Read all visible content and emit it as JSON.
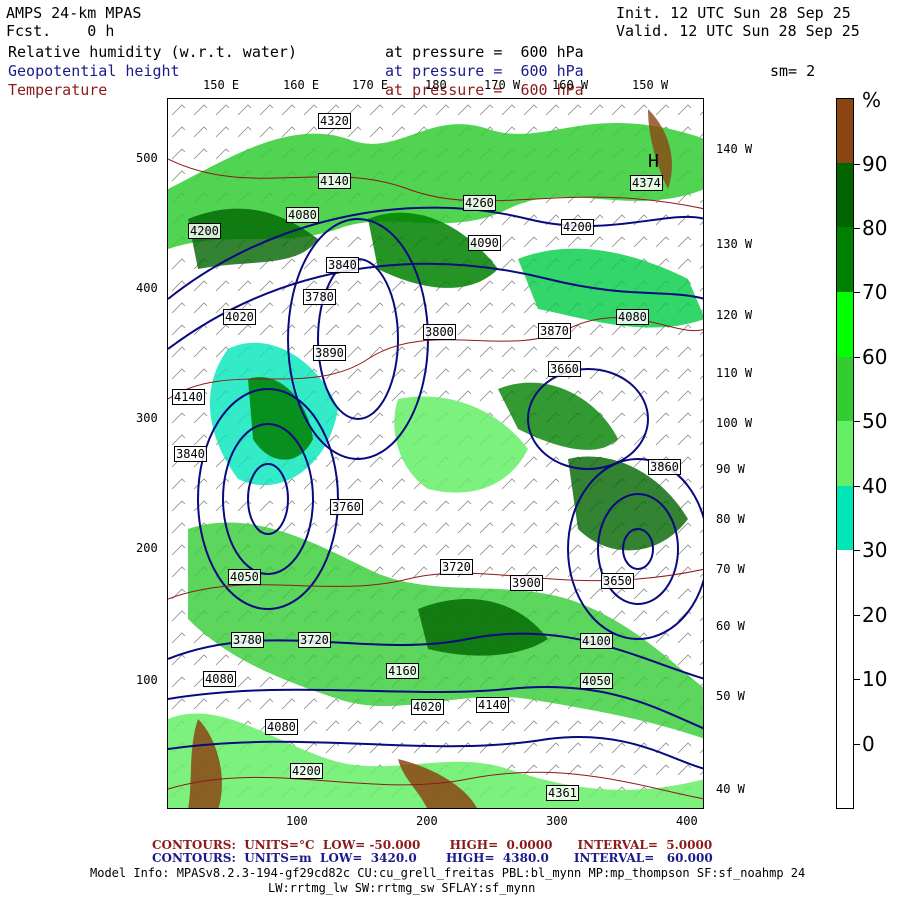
{
  "header": {
    "model": "AMPS 24-km MPAS",
    "fcst": "Fcst.    0 h",
    "init": "Init. 12 UTC Sun 28 Sep 25",
    "valid": "Valid. 12 UTC Sun 28 Sep 25"
  },
  "fields": [
    {
      "name": "Relative humidity (w.r.t. water)",
      "level": "at pressure =  600 hPa",
      "color": "#000000"
    },
    {
      "name": "Geopotential height",
      "level": "at pressure =  600 hPa",
      "color": "#1a1a8c"
    },
    {
      "name": "Temperature",
      "level": "at pressure =  600 hPa",
      "color": "#8b1a1a"
    }
  ],
  "smoothing": "sm= 2",
  "map": {
    "top_lon_labels": [
      "150 E",
      "160 E",
      "170 E",
      "180",
      "170 W",
      "160 W",
      "150 W"
    ],
    "right_lon_labels": [
      "140 W",
      "130 W",
      "120 W",
      "110 W",
      "100 W",
      "90 W",
      "80 W",
      "70 W",
      "60 W",
      "50 W",
      "40 W"
    ],
    "y_ticks": [
      "500",
      "400",
      "300",
      "200",
      "100"
    ],
    "x_ticks": [
      "100",
      "200",
      "300",
      "400"
    ],
    "height_labels": [
      "4320",
      "4140",
      "4080",
      "4200",
      "4260",
      "4090",
      "4200",
      "3840",
      "3780",
      "4020",
      "3800",
      "3890",
      "3870",
      "3660",
      "4080",
      "4140",
      "3840",
      "3760",
      "3720",
      "3900",
      "4050",
      "3780",
      "3720",
      "4080",
      "4080",
      "4160",
      "4020",
      "4140",
      "4200",
      "4361",
      "4374",
      "3650",
      "3860",
      "4100",
      "4050"
    ],
    "low_high_labels": [
      "H"
    ]
  },
  "colorbar": {
    "unit": "%",
    "labels": [
      "90",
      "80",
      "70",
      "60",
      "50",
      "40",
      "30",
      "20",
      "10",
      "0"
    ],
    "colors": [
      "#8b4513",
      "#006400",
      "#008000",
      "#00ff00",
      "#33cc33",
      "#66ee66",
      "#00e6b8",
      "#ffffff",
      "#ffffff",
      "#ffffff",
      "#ffffff"
    ]
  },
  "footer": {
    "temp_contours": "CONTOURS:  UNITS=°C  LOW= -50.000       HIGH=  0.0000      INTERVAL=  5.0000",
    "height_contours": "CONTOURS:  UNITS=m  LOW=  3420.0       HIGH=  4380.0      INTERVAL=   60.000",
    "model_info_1": "Model Info: MPASv8.2.3-194-gf29cd82c CU:cu_grell_freitas PBL:bl_mynn MP:mp_thompson SF:sf_noahmp 24",
    "model_info_2": "LW:rrtmg_lw SW:rrtmg_sw SFLAY:sf_mynn"
  }
}
